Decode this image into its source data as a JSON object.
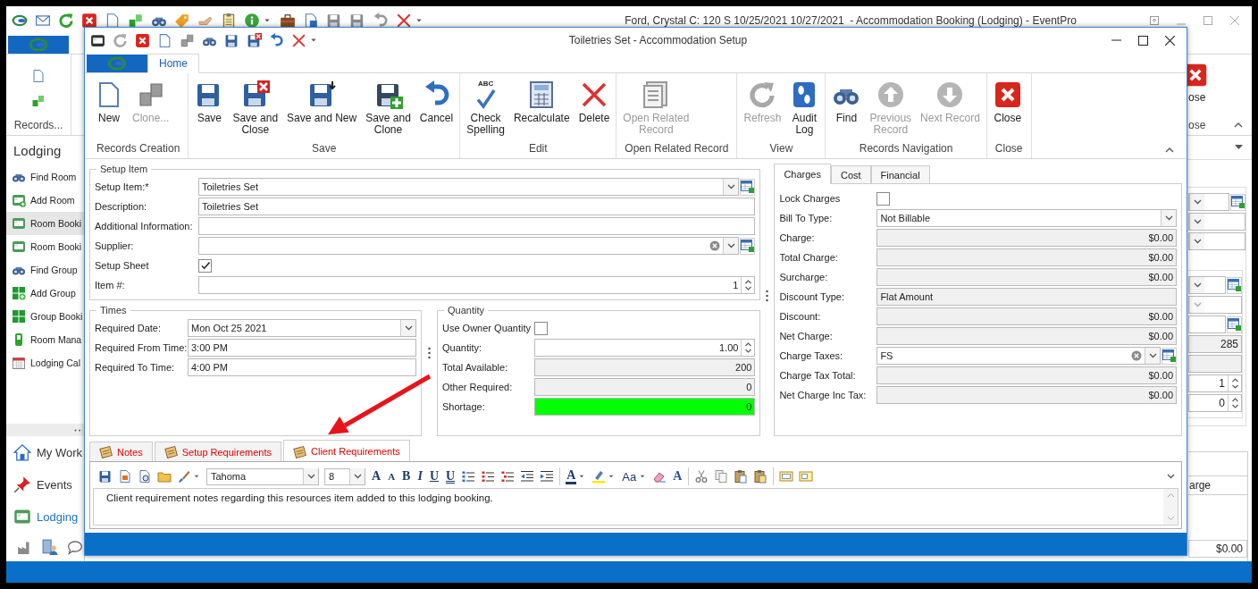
{
  "main_window": {
    "title": "Ford, Crystal C: 120 S 10/25/2021 10/27/2021  - Accommodation Booking (Lodging) - EventPro",
    "ribbon_group": "Records...",
    "cut_button_label": "ose",
    "cut_group_label": "ose"
  },
  "sidebar": {
    "title": "Lodging",
    "items": [
      {
        "label": "Find Room",
        "selected": false
      },
      {
        "label": "Add Room",
        "selected": false
      },
      {
        "label": "Room Booki",
        "selected": true
      },
      {
        "label": "Room Booki",
        "selected": false
      },
      {
        "label": "Find Group",
        "selected": false
      },
      {
        "label": "Add Group",
        "selected": false
      },
      {
        "label": "Group Booki",
        "selected": false
      },
      {
        "label": "Room Mana",
        "selected": false
      },
      {
        "label": "Lodging Cal",
        "selected": false
      }
    ],
    "nav": [
      {
        "label": "My Work",
        "selected": false
      },
      {
        "label": "Events",
        "selected": false
      },
      {
        "label": "Lodging",
        "selected": true
      }
    ]
  },
  "right_strip": {
    "values": [
      "285",
      "1",
      "0"
    ],
    "column_header": "arge",
    "total": "$0.00"
  },
  "dialog": {
    "title": "Toiletries Set - Accommodation Setup",
    "tab": {
      "label": "Home",
      "selected": true
    },
    "groups": [
      {
        "label": "Records Creation",
        "buttons": [
          {
            "label": "New",
            "disabled": false
          },
          {
            "label": "Clone...",
            "disabled": true
          }
        ]
      },
      {
        "label": "Save",
        "buttons": [
          {
            "label": "Save",
            "disabled": false
          },
          {
            "label": "Save and\nClose",
            "disabled": false
          },
          {
            "label": "Save and New",
            "disabled": false
          },
          {
            "label": "Save and\nClone",
            "disabled": false
          },
          {
            "label": "Cancel",
            "disabled": false
          }
        ]
      },
      {
        "label": "Edit",
        "buttons": [
          {
            "label": "Check\nSpelling",
            "disabled": false,
            "badge": "ABC"
          },
          {
            "label": "Recalculate",
            "disabled": false
          },
          {
            "label": "Delete",
            "disabled": false
          }
        ]
      },
      {
        "label": "Open Related Record",
        "buttons": [
          {
            "label": "Open Related\nRecord",
            "disabled": true
          }
        ]
      },
      {
        "label": "View",
        "buttons": [
          {
            "label": "Refresh",
            "disabled": true
          },
          {
            "label": "Audit\nLog",
            "disabled": false
          }
        ]
      },
      {
        "label": "Records Navigation",
        "buttons": [
          {
            "label": "Find",
            "disabled": false
          },
          {
            "label": "Previous\nRecord",
            "disabled": true
          },
          {
            "label": "Next Record",
            "disabled": true
          }
        ]
      },
      {
        "label": "Close",
        "buttons": [
          {
            "label": "Close",
            "disabled": false
          }
        ]
      }
    ]
  },
  "setup_item": {
    "title": "Setup Item",
    "fields": [
      {
        "kind": "lookup",
        "label": "Setup Item:*",
        "value": "Toiletries Set"
      },
      {
        "kind": "text",
        "label": "Description:",
        "value": "Toiletries Set"
      },
      {
        "kind": "text",
        "label": "Additional Information:"
      },
      {
        "kind": "lookup-clear",
        "label": "Supplier:"
      },
      {
        "kind": "checkbox",
        "label": "Setup Sheet",
        "checked": true
      },
      {
        "kind": "spin",
        "label": "Item #:",
        "value": "1"
      }
    ]
  },
  "times": {
    "title": "Times",
    "fields": [
      {
        "kind": "dropdown",
        "label": "Required Date:",
        "value": "Mon Oct 25 2021"
      },
      {
        "kind": "text",
        "label": "Required From Time:",
        "value": "3:00 PM"
      },
      {
        "kind": "text",
        "label": "Required To Time:",
        "value": "4:00 PM"
      }
    ]
  },
  "quantity": {
    "title": "Quantity",
    "fields": [
      {
        "kind": "checkbox",
        "label": "Use Owner Quantity",
        "checked": false
      },
      {
        "kind": "spin",
        "label": "Quantity:",
        "value": "1.00"
      },
      {
        "kind": "amount",
        "label": "Total Available:",
        "value": "200"
      },
      {
        "kind": "amount",
        "label": "Other Required:",
        "value": "0"
      },
      {
        "kind": "indicator",
        "label": "Shortage:",
        "value": "0",
        "color": "#00ff00"
      }
    ]
  },
  "charges": {
    "tabs": [
      {
        "label": "Charges",
        "selected": true
      },
      {
        "label": "Cost",
        "selected": false
      },
      {
        "label": "Financial",
        "selected": false
      }
    ],
    "fields": [
      {
        "kind": "checkbox",
        "label": "Lock Charges",
        "checked": false
      },
      {
        "kind": "dropdown",
        "label": "Bill To Type:",
        "value": "Not Billable"
      },
      {
        "kind": "amount",
        "label": "Charge:",
        "value": "$0.00"
      },
      {
        "kind": "amount",
        "label": "Total Charge:",
        "value": "$0.00"
      },
      {
        "kind": "amount",
        "label": "Surcharge:",
        "value": "$0.00"
      },
      {
        "kind": "readonly",
        "label": "Discount Type:",
        "value": "Flat Amount"
      },
      {
        "kind": "amount",
        "label": "Discount:",
        "value": "$0.00"
      },
      {
        "kind": "amount",
        "label": "Net Charge:",
        "value": "$0.00"
      },
      {
        "kind": "lookup-clear",
        "label": "Charge Taxes:",
        "value": "FS"
      },
      {
        "kind": "amount",
        "label": "Charge Tax Total:",
        "value": "$0.00"
      },
      {
        "kind": "amount",
        "label": "Net Charge Inc Tax:",
        "value": "$0.00"
      }
    ]
  },
  "notes": {
    "tabs": [
      {
        "label": "Notes",
        "selected": false
      },
      {
        "label": "Setup Requirements",
        "selected": false
      },
      {
        "label": "Client Requirements",
        "selected": true
      }
    ],
    "editor": {
      "font": "Tahoma",
      "size": "8",
      "glyphs": [
        "A",
        "A",
        "B",
        "I",
        "U",
        "U",
        "A",
        "Aa",
        "A"
      ],
      "text": "Client requirement notes regarding this resources item added to this lodging booking."
    }
  }
}
